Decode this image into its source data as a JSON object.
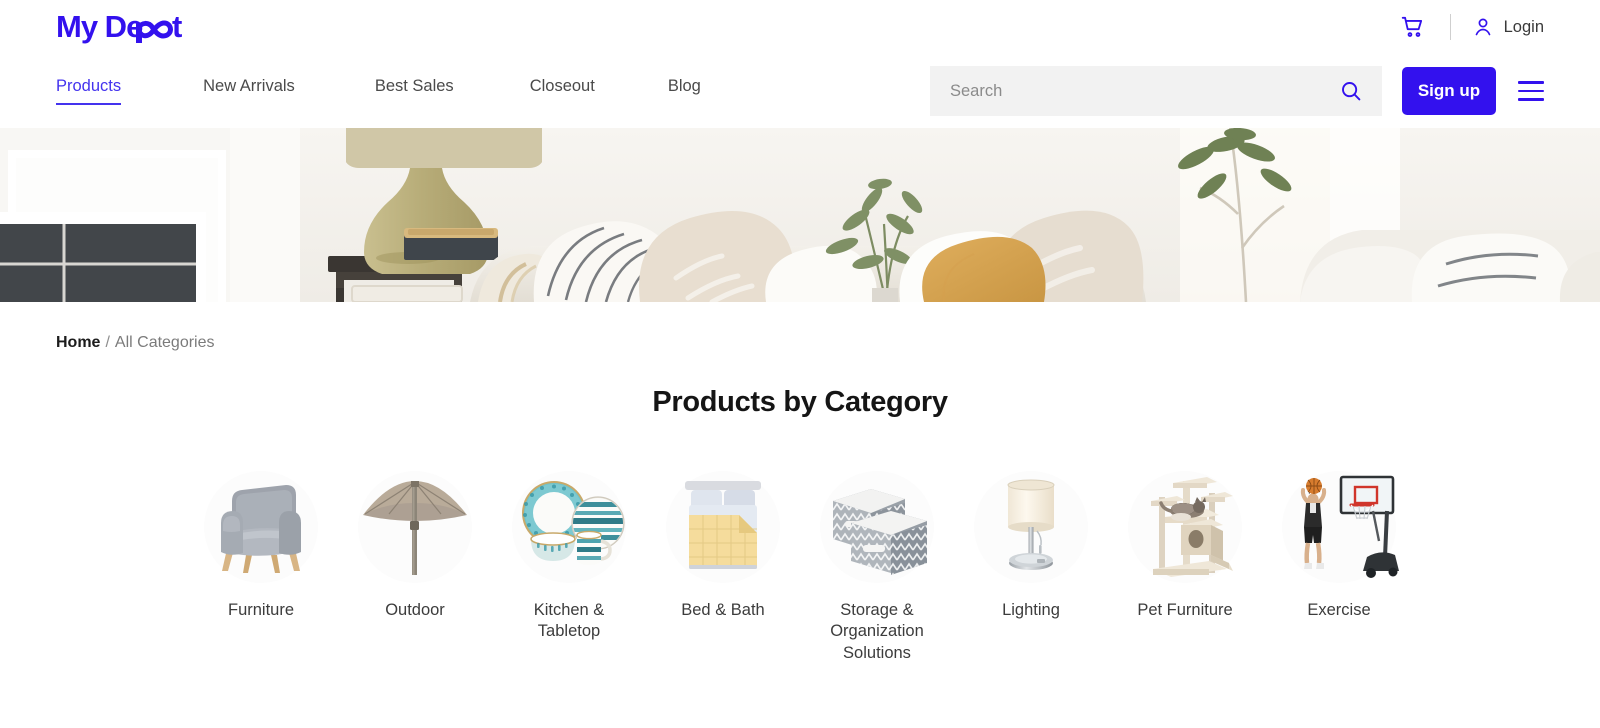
{
  "brand": {
    "name": "My Depot",
    "color": "#3311ee"
  },
  "topbar": {
    "cart_icon": "shopping-cart-icon",
    "user_icon": "user-account-icon",
    "login_label": "Login"
  },
  "nav": {
    "items": [
      {
        "label": "Products",
        "active": true
      },
      {
        "label": "New Arrivals",
        "active": false
      },
      {
        "label": "Best Sales",
        "active": false
      },
      {
        "label": "Closeout",
        "active": false
      },
      {
        "label": "Blog",
        "active": false
      }
    ],
    "search": {
      "placeholder": "Search",
      "value": "",
      "icon": "search-icon"
    },
    "signup_label": "Sign up",
    "menu_icon": "hamburger-menu-icon"
  },
  "hero": {
    "alt": "living room with sofa, pillows, lamp and plants"
  },
  "breadcrumb": {
    "home": "Home",
    "separator": "/",
    "current": "All Categories"
  },
  "main": {
    "title": "Products by Category",
    "categories": [
      {
        "label": "Furniture",
        "icon": "armchair-thumbnail"
      },
      {
        "label": "Outdoor",
        "icon": "patio-umbrella-thumbnail"
      },
      {
        "label": "Kitchen & Tabletop",
        "icon": "dinnerware-thumbnail"
      },
      {
        "label": "Bed & Bath",
        "icon": "bed-comforter-thumbnail"
      },
      {
        "label": "Storage & Organization Solutions",
        "icon": "storage-bins-thumbnail"
      },
      {
        "label": "Lighting",
        "icon": "table-lamp-thumbnail"
      },
      {
        "label": "Pet Furniture",
        "icon": "cat-tree-thumbnail"
      },
      {
        "label": "Exercise",
        "icon": "basketball-hoop-thumbnail"
      }
    ]
  },
  "colors": {
    "accent": "#3311ee",
    "nav_active": "#4433ee",
    "text": "#3c3c3c",
    "search_bg": "#f2f2f2"
  }
}
